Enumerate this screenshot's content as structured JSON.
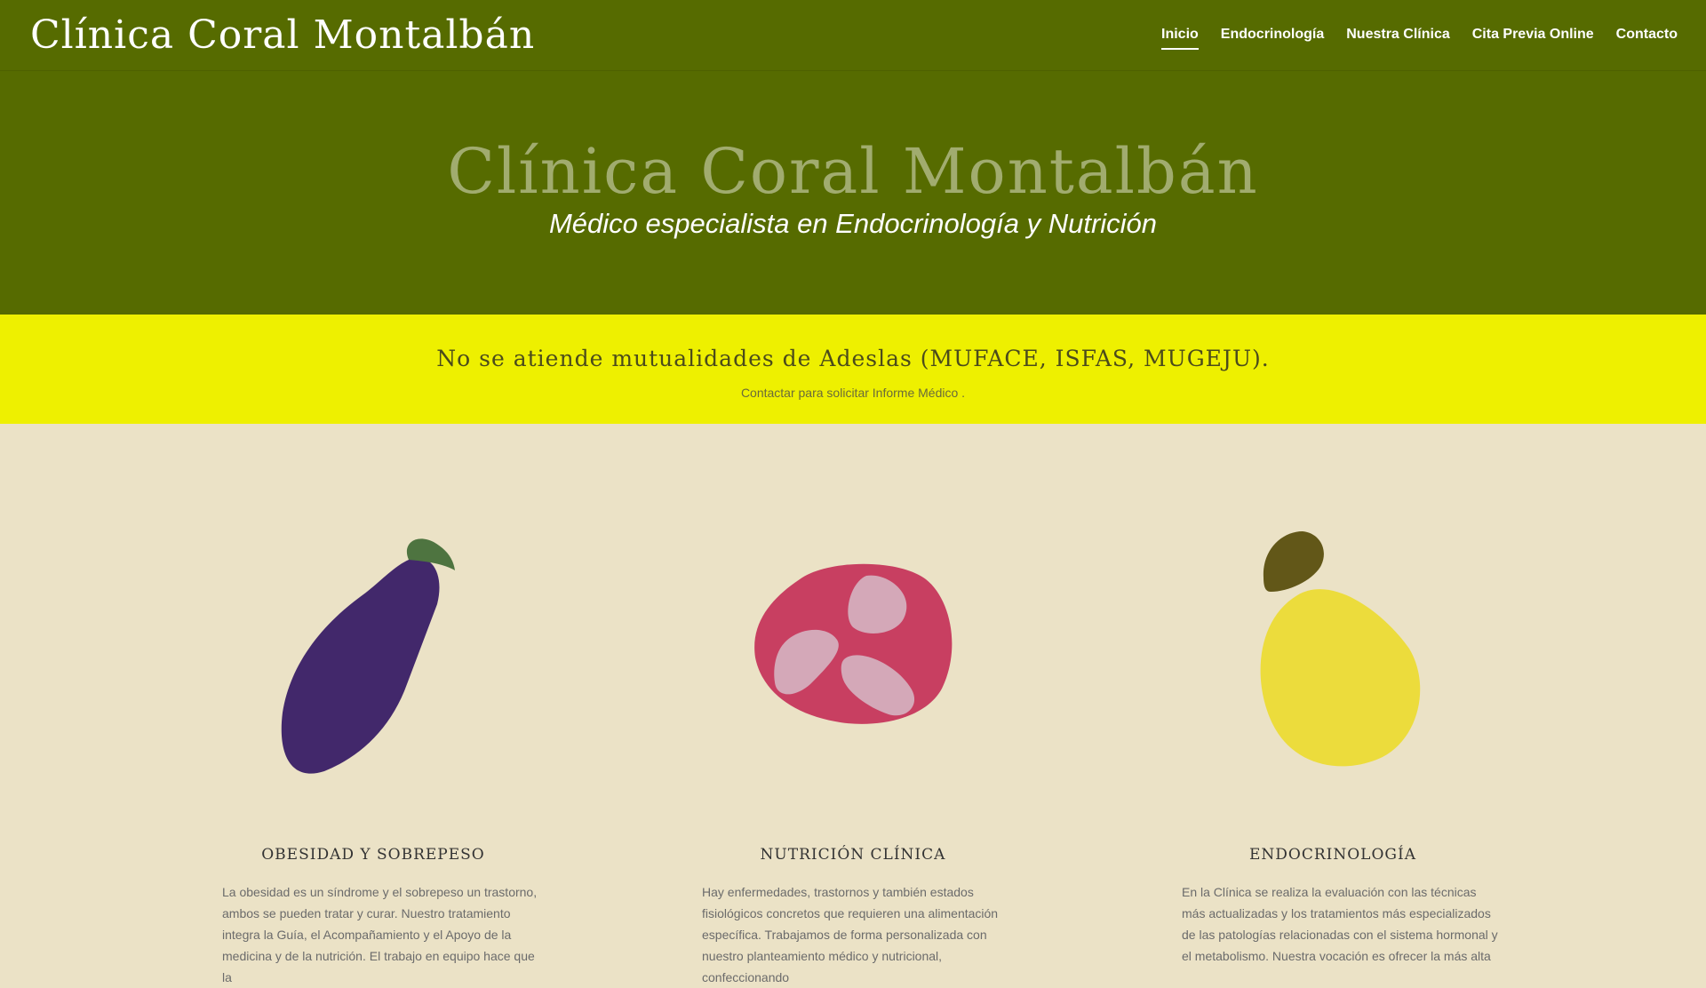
{
  "header": {
    "site_title": "Clínica Coral Montalbán",
    "nav": [
      "Inicio",
      "Endocrinología",
      "Nuestra Clínica",
      "Cita Previa Online",
      "Contacto"
    ]
  },
  "hero": {
    "title": "Clínica Coral Montalbán",
    "subtitle": "Médico especialista en Endocrinología y Nutrición"
  },
  "notice": {
    "title": "No se atiende mutualidades de Adeslas (MUFACE, ISFAS, MUGEJU).",
    "subtitle": "Contactar para solicitar Informe Médico ."
  },
  "services": [
    {
      "icon": "eggplant-icon",
      "title": "OBESIDAD Y SOBREPESO",
      "text": "La obesidad es un síndrome y el sobrepeso un trastorno, ambos se pueden tratar y curar. Nuestro tratamiento integra la Guía, el Acompañamiento y el Apoyo de la medicina y de la nutrición. El trabajo en equipo hace que la"
    },
    {
      "icon": "pomegranate-icon",
      "title": "NUTRICIÓN CLÍNICA",
      "text": "Hay enfermedades, trastornos y también estados fisiológicos concretos que requieren una alimentación específica. Trabajamos de forma personalizada con nuestro planteamiento médico y nutricional, confeccionando"
    },
    {
      "icon": "pear-icon",
      "title": "ENDOCRINOLOGÍA",
      "text": "En la Clínica se realiza la evaluación con las técnicas más actualizadas y los tratamientos más especializados  de las patologías relacionadas con el sistema hormonal y el metabolismo. Nuestra vocación es ofrecer la más alta"
    }
  ],
  "colors": {
    "header_bg": "#566b00",
    "notice_bg": "#eef000",
    "page_bg": "#ebe2c6",
    "eggplant": "#42286b",
    "pomegranate": "#c83f61",
    "pear": "#ecdc3c"
  }
}
